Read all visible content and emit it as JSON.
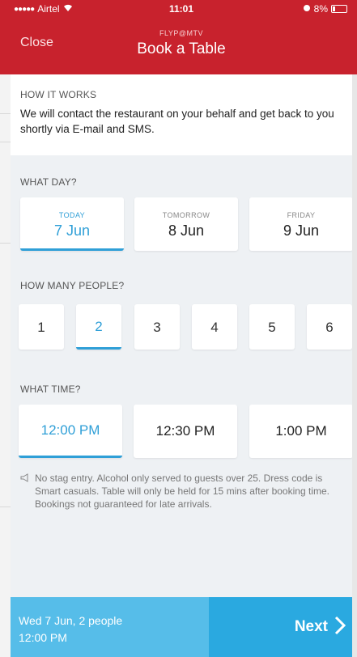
{
  "status_bar": {
    "carrier": "Airtel",
    "time": "11:01",
    "battery": "8%"
  },
  "header": {
    "close_label": "Close",
    "subtitle": "FLYP@MTV",
    "title": "Book a Table"
  },
  "how_it_works": {
    "label": "HOW IT WORKS",
    "text": "We will contact the restaurant on your behalf and get back to you shortly via E-mail and SMS."
  },
  "day_section": {
    "label": "WHAT DAY?",
    "options": [
      {
        "top": "TODAY",
        "main": "7 Jun",
        "selected": true
      },
      {
        "top": "TOMORROW",
        "main": "8 Jun",
        "selected": false
      },
      {
        "top": "FRIDAY",
        "main": "9 Jun",
        "selected": false
      }
    ]
  },
  "people_section": {
    "label": "HOW MANY PEOPLE?",
    "options": [
      "1",
      "2",
      "3",
      "4",
      "5",
      "6"
    ],
    "selected": "2"
  },
  "time_section": {
    "label": "WHAT TIME?",
    "options": [
      "12:00 PM",
      "12:30 PM",
      "1:00 PM"
    ],
    "selected": "12:00 PM"
  },
  "note": {
    "text": "No stag entry. Alcohol only served to guests over 25. Dress code is Smart casuals. Table will only be held for 15 mins after booking time. Bookings not guaranteed for late arrivals."
  },
  "footer": {
    "summary_line1": "Wed 7 Jun, 2 people",
    "summary_line2": "12:00 PM",
    "next_label": "Next"
  },
  "colors": {
    "header_red": "#c8222d",
    "accent_blue": "#2f9fd7",
    "footer_light_blue": "#56bde9",
    "footer_blue": "#2aa9e0",
    "background": "#eef1f4"
  }
}
